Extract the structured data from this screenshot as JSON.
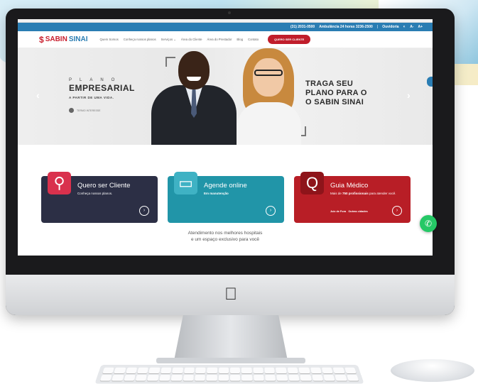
{
  "topbar": {
    "phone": "(31) 2031-0500",
    "ambulancia": "Ambulância 24 horas 3236-2500",
    "separator": "|",
    "ouvidoria": "Ouvidoria",
    "font_minus": "A-",
    "font_plus": "A+"
  },
  "brand": {
    "symbol": "$",
    "name_part1": "SABIN",
    "name_part2": "SINAI",
    "red": "#c91f2e",
    "blue": "#2a7db3"
  },
  "nav": {
    "items": [
      "Quem Somos",
      "Conheça nossos planos",
      "Serviços ⌄",
      "Área do Cliente",
      "Área do Prestador",
      "Blog",
      "Contato"
    ],
    "cta": "QUERO SER CLIENTE"
  },
  "hero": {
    "plano": "PLANO",
    "title": "EMPRESARIAL",
    "subtitle": "A PARTIR DE UMA VIDA.",
    "termo": "TERMO INTERESSE",
    "right_line1": "TRAGA SEU",
    "right_line2": "PLANO PARA O",
    "right_line3": "O SABIN SINAI",
    "prev": "‹",
    "next": "›"
  },
  "cards": [
    {
      "title": "Quero ser Cliente",
      "sub": "Conheça nossos planos.",
      "icon": "person-plus-icon",
      "color": "#2c2f45"
    },
    {
      "title": "Agende online",
      "sub": "Em manutenção",
      "icon": "monitor-icon",
      "color": "#2195a8"
    },
    {
      "title": "Guia Médico",
      "sub_prefix": "Mais de ",
      "sub_bold": "750 profissionais",
      "sub_suffix": " para atender você.",
      "link1": "Juiz de Fora",
      "link2": "Outras cidades",
      "icon": "search-doc-icon",
      "color": "#b81e26"
    }
  ],
  "tagline": {
    "line1": "Atendimento nos melhores hospitais",
    "line2": "e um espaço exclusivo para você"
  },
  "card_button_glyph": "›",
  "whatsapp_glyph": "✆"
}
